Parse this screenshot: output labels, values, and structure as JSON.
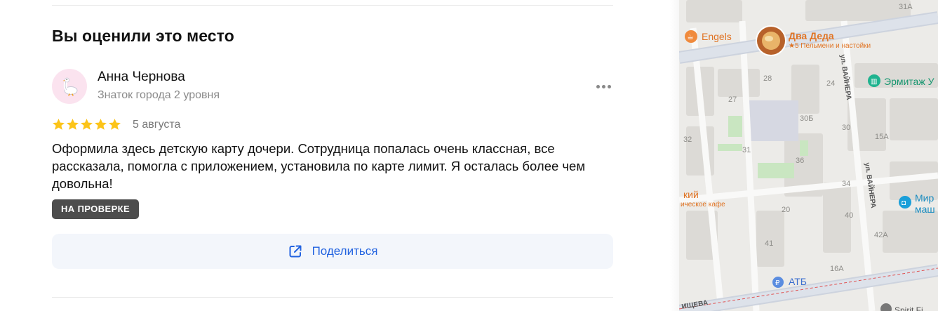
{
  "review_section": {
    "title": "Вы оценили это место",
    "author": {
      "name": "Анна Чернова",
      "level": "Знаток города 2 уровня",
      "avatar_icon": "goose-icon"
    },
    "rating": 5,
    "max_rating": 5,
    "date": "5 августа",
    "text": "Оформила здесь детскую карту дочери. Сотрудница попалась очень классная, все рассказала, помогла с приложением, установила по карте лимит. Я осталась более чем довольна!",
    "status_badge": "НА ПРОВЕРКЕ",
    "share_label": "Поделиться",
    "colors": {
      "star": "#fcc419",
      "badge_bg": "#4d4d4d",
      "link": "#2263e0",
      "share_bg": "#f3f6fb"
    }
  },
  "map": {
    "pois": {
      "engels": "Engels",
      "dva_deda": "Два Деда",
      "dva_deda_sub": "★5 Пельмени и настойки",
      "ermitazh": "Эрмитаж У",
      "kafe_partial": "кий",
      "kafe_sub_partial": "ическое кафе",
      "mir": "Мир",
      "mir_sub": "маш",
      "atb": "АТБ",
      "spirit": "Spirit Fi"
    },
    "streets": {
      "vaynera_1": "ул. ВАЙНЕРА",
      "vaynera_2": "ул. ВАЙНЕРА",
      "bottom": "ИЩЕВА"
    },
    "house_numbers": {
      "n31a": "31А",
      "n28": "28",
      "n24": "24",
      "n27": "27",
      "n30b": "30Б",
      "n30": "30",
      "n15a": "15А",
      "n32": "32",
      "n31": "31",
      "n36": "36",
      "n34": "34",
      "n40": "40",
      "n20": "20",
      "n42a": "42А",
      "n41": "41",
      "n16a": "16А"
    }
  }
}
